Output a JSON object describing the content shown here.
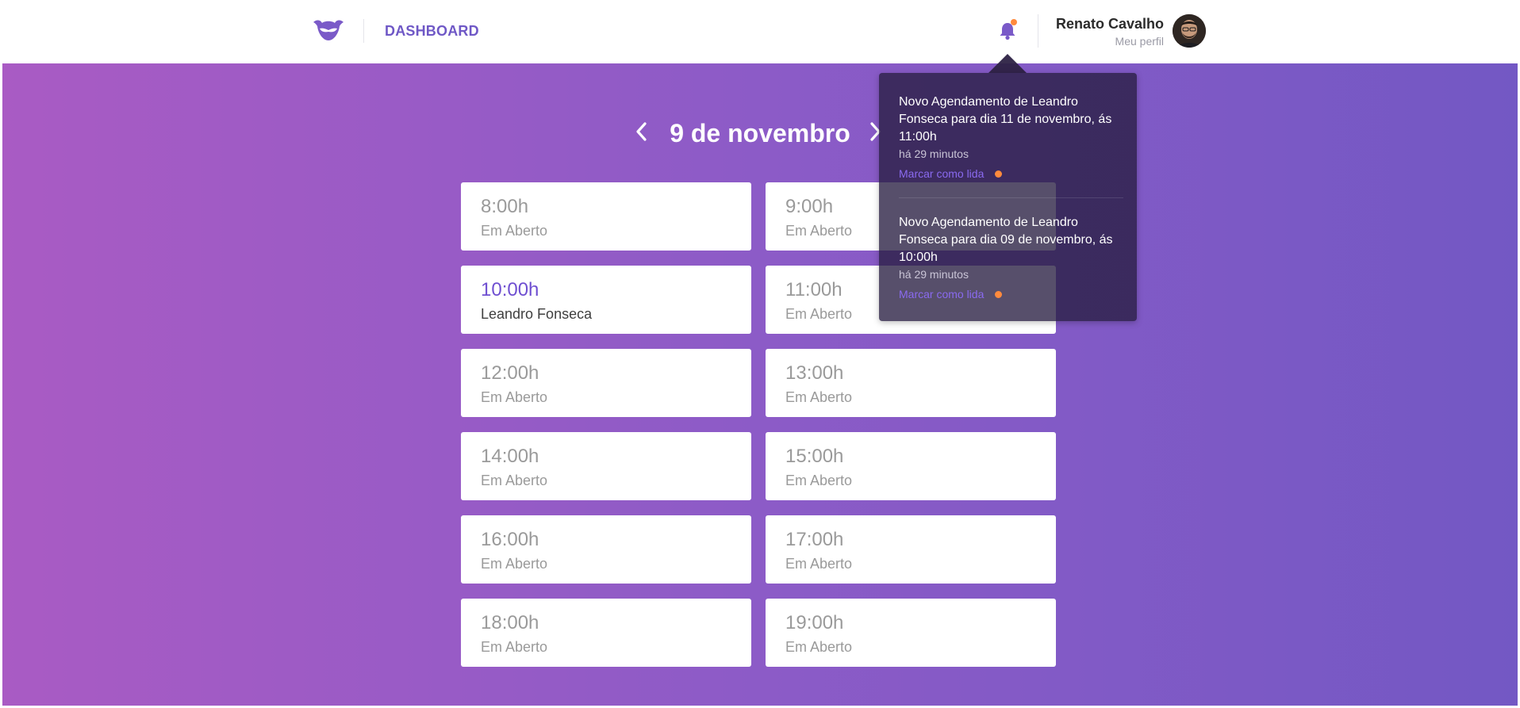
{
  "header": {
    "dashboard_label": "DASHBOARD",
    "user_name": "Renato Cavalho",
    "profile_link": "Meu perfil",
    "accent_color": "#6f58c6",
    "bell_icon": "bell-icon",
    "logo_icon": "mustache-logo"
  },
  "schedule": {
    "date_title": "9 de novembro",
    "prev_icon": "chevron-left-icon",
    "next_icon": "chevron-right-icon",
    "slots": [
      {
        "time": "8:00h",
        "status": "Em Aberto"
      },
      {
        "time": "9:00h",
        "status": "Em Aberto"
      },
      {
        "time": "10:00h",
        "status": "Leandro Fonseca"
      },
      {
        "time": "11:00h",
        "status": "Em Aberto"
      },
      {
        "time": "12:00h",
        "status": "Em Aberto"
      },
      {
        "time": "13:00h",
        "status": "Em Aberto"
      },
      {
        "time": "14:00h",
        "status": "Em Aberto"
      },
      {
        "time": "15:00h",
        "status": "Em Aberto"
      },
      {
        "time": "16:00h",
        "status": "Em Aberto"
      },
      {
        "time": "17:00h",
        "status": "Em Aberto"
      },
      {
        "time": "18:00h",
        "status": "Em Aberto"
      },
      {
        "time": "19:00h",
        "status": "Em Aberto"
      }
    ]
  },
  "notifications": [
    {
      "text": "Novo Agendamento de Leandro Fonseca para dia 11 de novembro, ás 11:00h",
      "time_ago": "há 29 minutos",
      "mark_read": "Marcar como lida"
    },
    {
      "text": "Novo Agendamento de Leandro Fonseca para dia 09 de novembro, ás 10:00h",
      "time_ago": "há 29 minutos",
      "mark_read": "Marcar como lida"
    }
  ],
  "colors": {
    "gradient_start": "#a95bc4",
    "gradient_end": "#7358c4",
    "unread_dot": "#ff8a3d",
    "booked_time": "#6f4fd1"
  }
}
